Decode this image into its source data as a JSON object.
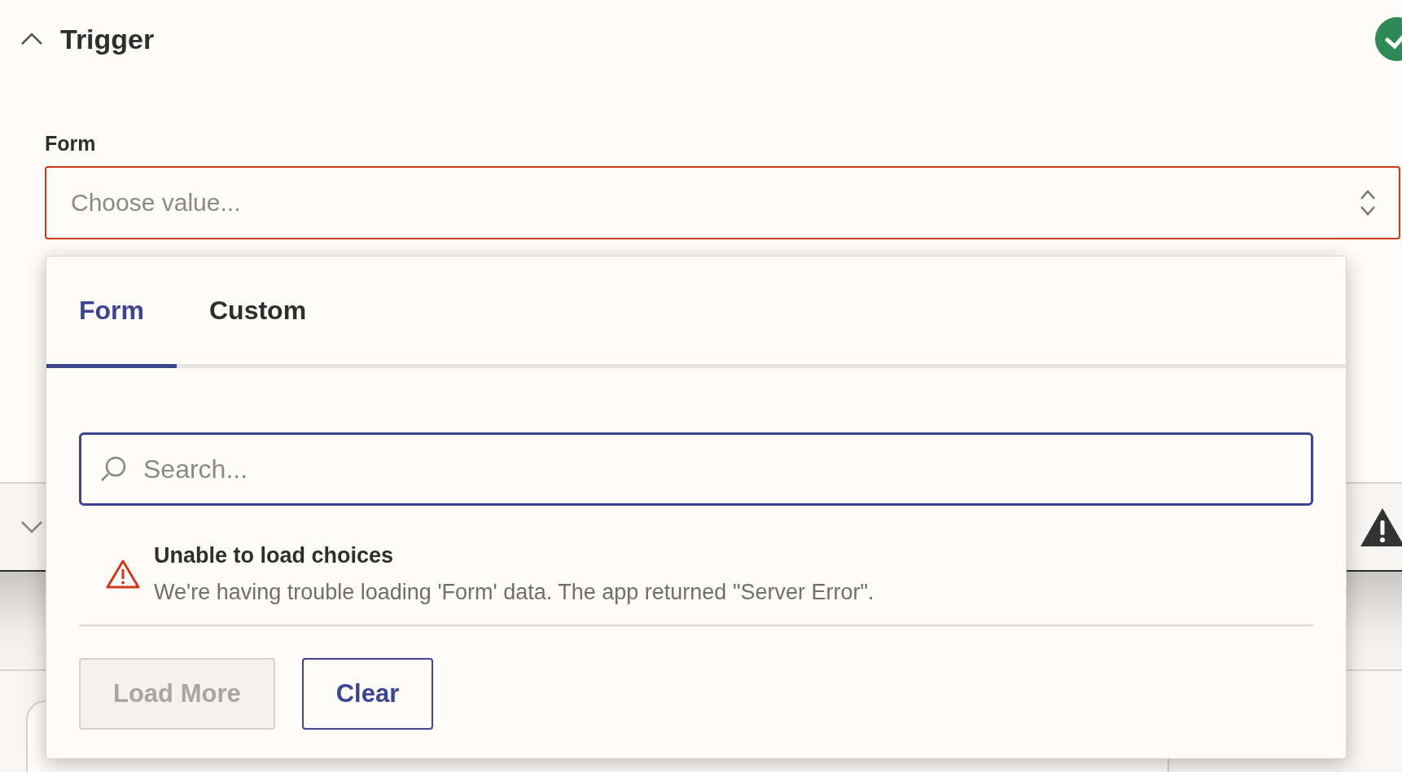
{
  "step": {
    "title": "Trigger",
    "expanded": true,
    "complete": true
  },
  "field": {
    "label": "Form",
    "placeholder": "Choose value...",
    "error": true
  },
  "dropdown": {
    "tabs": [
      {
        "label": "Form",
        "selected": true
      },
      {
        "label": "Custom",
        "selected": false
      }
    ],
    "search": {
      "placeholder": "Search..."
    },
    "message": {
      "kind": "error",
      "title": "Unable to load choices",
      "text": "We're having trouble loading 'Form' data. The app returned \"Server Error\"."
    },
    "buttons": [
      {
        "label": "Load More",
        "disabled": true
      },
      {
        "label": "Clear",
        "disabled": false
      }
    ]
  },
  "next_step": {
    "expanded": false,
    "warning": true
  }
}
